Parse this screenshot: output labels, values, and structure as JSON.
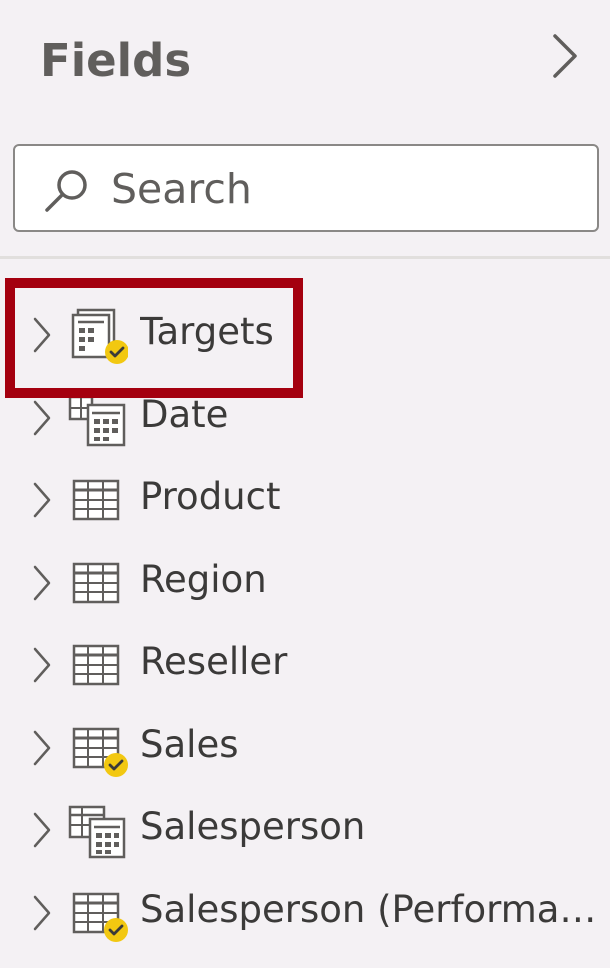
{
  "pane": {
    "title": "Fields",
    "collapse_icon": "chevron-right-icon"
  },
  "search": {
    "placeholder": "Search",
    "value": "",
    "icon": "search-icon"
  },
  "fields": [
    {
      "label": "Targets",
      "icon": "calculation-table-icon",
      "in_use": true,
      "highlighted": true
    },
    {
      "label": "Date",
      "icon": "date-calculated-table-icon",
      "in_use": false
    },
    {
      "label": "Product",
      "icon": "table-icon",
      "in_use": false
    },
    {
      "label": "Region",
      "icon": "table-icon",
      "in_use": false
    },
    {
      "label": "Reseller",
      "icon": "table-icon",
      "in_use": false
    },
    {
      "label": "Sales",
      "icon": "table-icon",
      "in_use": true
    },
    {
      "label": "Salesperson",
      "icon": "calculated-table-icon",
      "in_use": false
    },
    {
      "label": "Salesperson (Performan…",
      "icon": "table-icon",
      "in_use": true
    }
  ],
  "colors": {
    "background": "#f4f1f4",
    "highlight_border": "#a4000f",
    "in_use_badge": "#f2c811"
  }
}
